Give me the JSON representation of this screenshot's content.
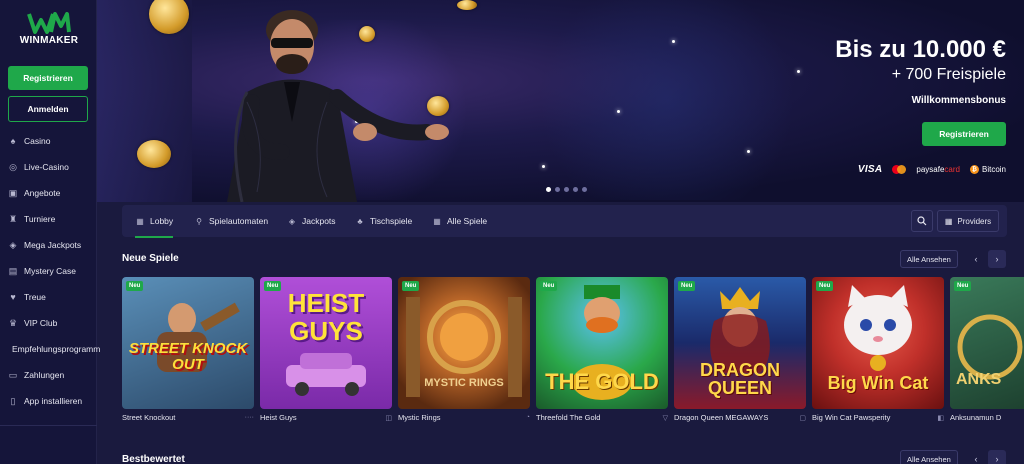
{
  "brand": {
    "name": "WINMAKER",
    "accent": "#1fa84a"
  },
  "sidebar": {
    "register_label": "Registrieren",
    "login_label": "Anmelden",
    "items": [
      {
        "label": "Casino",
        "icon": "spade-icon"
      },
      {
        "label": "Live-Casino",
        "icon": "chip-icon"
      },
      {
        "label": "Angebote",
        "icon": "gift-icon"
      },
      {
        "label": "Turniere",
        "icon": "trophy-icon"
      },
      {
        "label": "Mega Jackpots",
        "icon": "jackpot-icon"
      },
      {
        "label": "Mystery Case",
        "icon": "case-icon"
      },
      {
        "label": "Treue",
        "icon": "heart-icon"
      },
      {
        "label": "VIP Club",
        "icon": "crown-icon"
      },
      {
        "label": "Empfehlungsprogramm",
        "icon": ""
      },
      {
        "label": "Zahlungen",
        "icon": "wallet-icon"
      },
      {
        "label": "App installieren",
        "icon": "phone-icon"
      }
    ]
  },
  "hero": {
    "title": "Bis zu 10.000 €",
    "subtitle": "+ 700 Freispiele",
    "label": "Willkommensbonus",
    "cta_label": "Registrieren",
    "payments": {
      "visa": "VISA",
      "paysafe_a": "paysafe",
      "paysafe_b": "card",
      "bitcoin": "Bitcoin"
    }
  },
  "tabs": [
    {
      "label": "Lobby",
      "icon": "grid-icon"
    },
    {
      "label": "Spielautomaten",
      "icon": "slot-icon"
    },
    {
      "label": "Jackpots",
      "icon": "jackpot-icon"
    },
    {
      "label": "Tischspiele",
      "icon": "cards-icon"
    },
    {
      "label": "Alle Spiele",
      "icon": "grid-icon"
    }
  ],
  "providers_label": "Providers",
  "sections": {
    "new": {
      "title": "Neue Spiele",
      "see_all": "Alle Ansehen"
    },
    "top": {
      "title": "Bestbewertet",
      "see_all": "Alle Ansehen"
    }
  },
  "games": [
    {
      "name": "Street Knockout",
      "badge": "Neu",
      "art": "STREET KNOCK OUT",
      "colors": [
        "#5a8fb8",
        "#2c4a6a"
      ]
    },
    {
      "name": "Heist Guys",
      "badge": "Neu",
      "art": "HEIST GUYS",
      "colors": [
        "#b04fd8",
        "#7a2aa8"
      ]
    },
    {
      "name": "Mystic Rings",
      "badge": "Neu",
      "art": "MYSTIC RINGS",
      "colors": [
        "#c06a2a",
        "#5a2a10"
      ]
    },
    {
      "name": "Threefold The Gold",
      "badge": "Neu",
      "art": "THE GOLD",
      "colors": [
        "#2aa84a",
        "#1a5a2a"
      ]
    },
    {
      "name": "Dragon Queen MEGAWAYS",
      "badge": "Neu",
      "art": "DRAGON QUEEN",
      "colors": [
        "#2a5aa8",
        "#8a1a2a"
      ]
    },
    {
      "name": "Big Win Cat Pawsperity",
      "badge": "Neu",
      "art": "Big Win Cat",
      "colors": [
        "#c0302a",
        "#6a1010"
      ]
    },
    {
      "name": "Anksunamun D",
      "badge": "Neu",
      "art": "ANKS",
      "colors": [
        "#3a7a5a",
        "#1a3a2a"
      ]
    }
  ]
}
